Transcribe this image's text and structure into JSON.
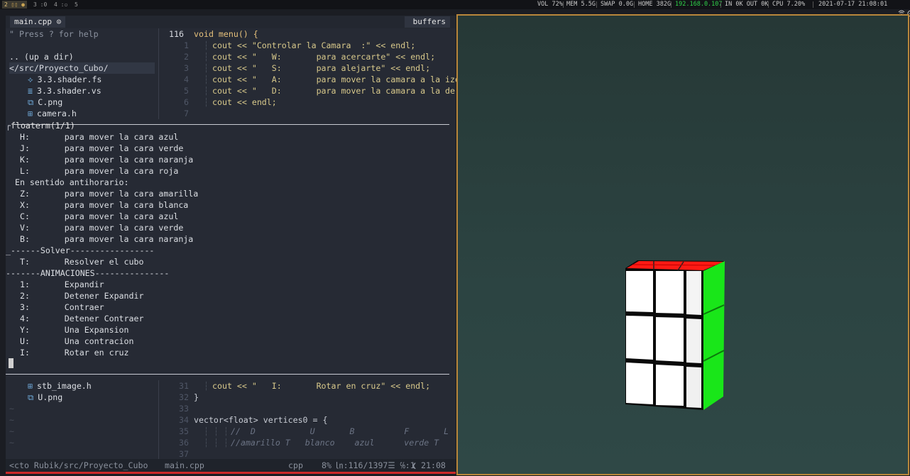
{
  "topbar": {
    "workspaces": [
      "2",
      "3",
      "4",
      "5"
    ],
    "active_workspace": "2",
    "vol": "VOL 72%",
    "mem": "MEM 5.5G",
    "swap": "SWAP 0.0G",
    "home": "HOME 382G",
    "ip": "192.168.0.107",
    "net": "IN 0K OUT 0K",
    "cpu": "CPU 7.20%",
    "datetime": "2021-07-17 21:08:01"
  },
  "editor": {
    "tab_label": "main.cpp ⊙",
    "buffers_label": "buffers",
    "help_text": "\" Press ? for help",
    "tree_top": [
      {
        "text": ".. (up a dir)",
        "indent": 0
      },
      {
        "text": "</src/Proyecto_Cubo/",
        "indent": 0,
        "selected": true
      },
      {
        "icon": "⟡",
        "text": "3.3.shader.fs",
        "indent": 1
      },
      {
        "icon": "≣",
        "text": "3.3.shader.vs",
        "indent": 1
      },
      {
        "icon": "⧉",
        "text": "C.png",
        "indent": 1
      },
      {
        "icon": "⊞",
        "text": "camera.h",
        "indent": 1
      }
    ],
    "tree_bottom": [
      {
        "icon": "⊞",
        "text": "stb_image.h"
      },
      {
        "icon": "⧉",
        "text": "U.png"
      }
    ],
    "code_top": [
      {
        "n": "116",
        "text": "void menu() {"
      },
      {
        "n": "1",
        "text": "cout << \"Controlar la Camara  :\" << endl;"
      },
      {
        "n": "2",
        "text": "cout << \"   W:       para acercarte\" << endl;"
      },
      {
        "n": "3",
        "text": "cout << \"   S:       para alejarte\" << endl;"
      },
      {
        "n": "4",
        "text": "cout << \"   A:       para mover la camara a la izq"
      },
      {
        "n": "5",
        "text": "cout << \"   D:       para mover la camara a la der"
      },
      {
        "n": "6",
        "text": "cout << endl;"
      },
      {
        "n": "7",
        "text": ""
      }
    ],
    "code_bottom": [
      {
        "n": "31",
        "text": "cout << \"   I:       Rotar en cruz\" << endl;"
      },
      {
        "n": "32",
        "text": "}"
      },
      {
        "n": "33",
        "text": ""
      },
      {
        "n": "34",
        "text": "vector<float> vertices0 = {"
      },
      {
        "n": "35",
        "text": "//  D           U       B          F       L"
      },
      {
        "n": "36",
        "text": "//amarillo T   blanco    azul      verde T"
      },
      {
        "n": "37",
        "text": ""
      }
    ]
  },
  "floaterm": {
    "title": "floaterm(1/1)",
    "lines": [
      "  H:       para mover la cara azul",
      "  J:       para mover la cara verde",
      "  K:       para mover la cara naranja",
      "  L:       para mover la cara roja",
      " En sentido antihorario:",
      "  Z:       para mover la cara amarilla",
      "  X:       para mover la cara blanca",
      "  C:       para mover la cara azul",
      "  V:       para mover la cara verde",
      "  B:       para mover la cara naranja",
      "_------Solver-----------------",
      "  T:       Resolver el cubo",
      "-------ANIMACIONES---------------",
      "  1:       Expandir",
      "  2:       Detener Expandir",
      "  3:       Contraer",
      "  4:       Detener Contraer",
      "  Y:       Una Expansion",
      "  U:       Una contracion",
      "  I:       Rotar en cruz"
    ]
  },
  "statusline": {
    "path": "<cto Rubik/src/Proyecto_Cubo",
    "file": "main.cpp",
    "filetype": "cpp",
    "percent": "8%",
    "position": "㏑:116/1397☰ ℅:1",
    "time": "21:08"
  },
  "colors": {
    "cube_top": "#ff1a14",
    "cube_front": "#ffffff",
    "cube_side": "#19e619",
    "viewport_border": "#b9873b"
  }
}
